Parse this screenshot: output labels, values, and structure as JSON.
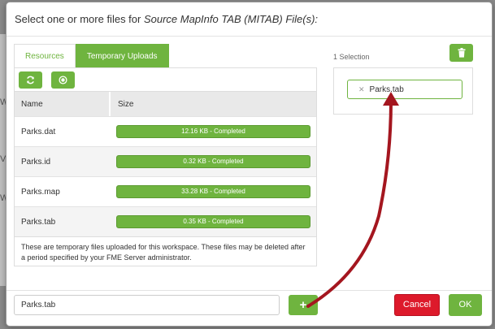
{
  "background": {
    "letters": [
      "W",
      "V",
      "W"
    ]
  },
  "dialog": {
    "title_prefix": "Select one or more files for ",
    "title_emphasis": "Source MapInfo TAB (MITAB) File(s):"
  },
  "tabs": [
    {
      "label": "Resources",
      "active": false
    },
    {
      "label": "Temporary Uploads",
      "active": true
    }
  ],
  "toolbar": {
    "refresh_icon": "refresh-icon",
    "record_icon": "record-icon"
  },
  "table": {
    "headers": {
      "name": "Name",
      "size": "Size"
    },
    "rows": [
      {
        "name": "Parks.dat",
        "status": "12.16 KB - Completed",
        "progress": 1.0
      },
      {
        "name": "Parks.id",
        "status": "0.32 KB - Completed",
        "progress": 1.0
      },
      {
        "name": "Parks.map",
        "status": "33.28 KB - Completed",
        "progress": 1.0
      },
      {
        "name": "Parks.tab",
        "status": "0.35 KB - Completed",
        "progress": 1.0
      }
    ]
  },
  "note": "These are temporary files uploaded for this workspace. These files may be deleted after a period specified by your FME Server administrator.",
  "selection": {
    "count_label": "1 Selection",
    "items": [
      {
        "label": "Parks.tab",
        "remove_glyph": "✕"
      }
    ]
  },
  "footer": {
    "input_value": "Parks.tab",
    "add_glyph": "+",
    "cancel_label": "Cancel",
    "ok_label": "OK"
  },
  "colors": {
    "accent": "#6fb43f",
    "danger": "#dd1a2b",
    "arrow": "#a4161f"
  }
}
